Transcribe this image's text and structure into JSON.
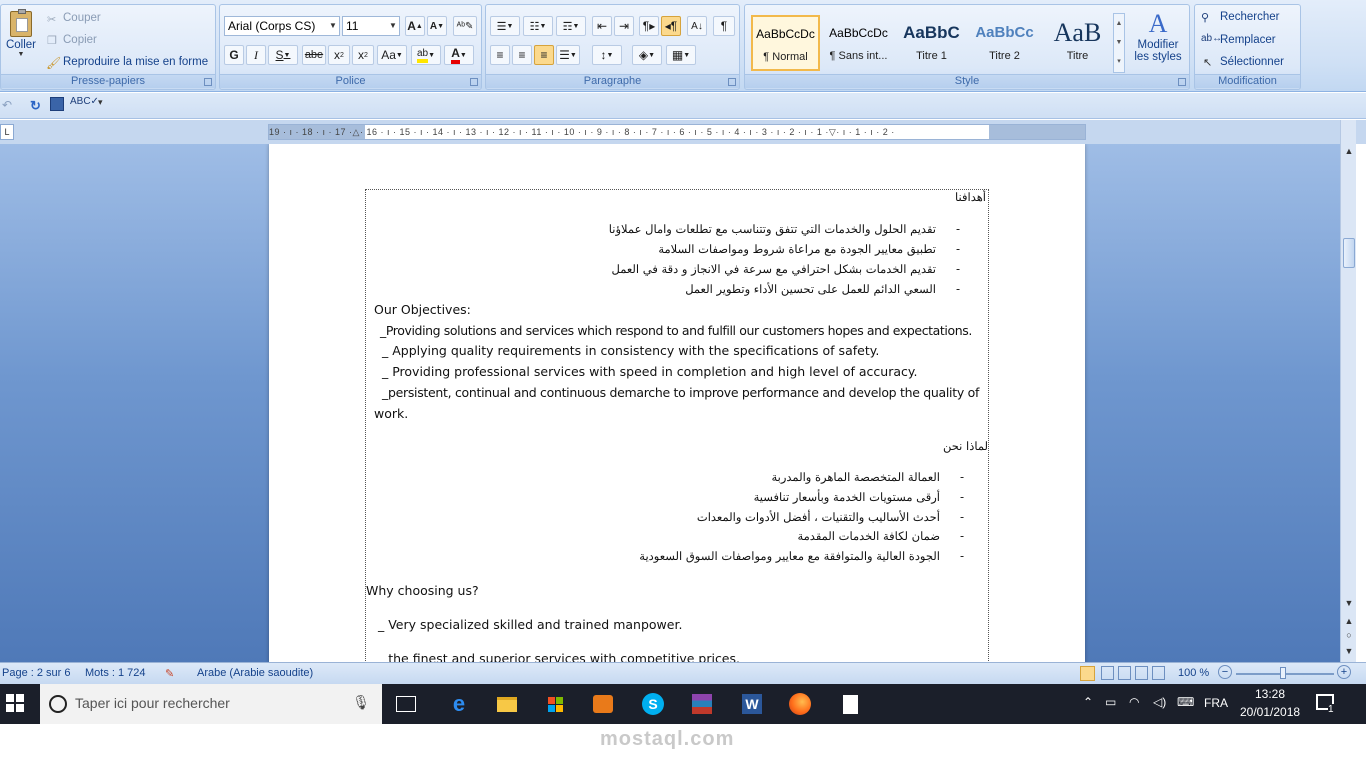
{
  "ribbon": {
    "clipboard": {
      "paste": "Coller",
      "cut": "Couper",
      "copy": "Copier",
      "format_painter": "Reproduire la mise en forme",
      "label": "Presse-papiers"
    },
    "font": {
      "font_name": "Arial (Corps CS)",
      "font_size": "11",
      "label": "Police"
    },
    "paragraph": {
      "label": "Paragraphe"
    },
    "styles": {
      "tiles": [
        {
          "preview": "AaBbCcDc",
          "name": "¶ Normal"
        },
        {
          "preview": "AaBbCcDc",
          "name": "¶ Sans int..."
        },
        {
          "preview": "AaBbC",
          "name": "Titre 1"
        },
        {
          "preview": "AaBbCc",
          "name": "Titre 2"
        },
        {
          "preview": "AaB",
          "name": "Titre"
        }
      ],
      "change_styles_1": "Modifier",
      "change_styles_2": "les styles",
      "label": "Style"
    },
    "editing": {
      "find": "Rechercher",
      "replace": "Remplacer",
      "select": "Sélectionner",
      "label": "Modification"
    }
  },
  "ruler": {
    "ticks": "19 · ı · 18 · ı · 17 ·△· 16 · ı · 15 · ı · 14 · ı · 13 · ı · 12 · ı · 11 · ı · 10 · ı · 9 · ı · 8 · ı · 7 · ı · 6 · ı · 5 · ı · 4 · ı · 3 · ı · 2 · ı · 1 ·▽· ı · 1 · ı · 2 ·"
  },
  "document": {
    "arabic_heading": "أهدافنا",
    "arabic_objectives": [
      "تقديم الحلول والخدمات التي تتفق وتتناسب مع تطلعات وامال عملاؤنا",
      "تطبيق معايير الجودة مع مراعاة شروط ومواصفات السلامة",
      "تقديم الخدمات بشكل احترافي مع سرعة في الانجاز و دقة في العمل",
      "السعي الدائم للعمل على تحسين الأداء وتطوير العمل"
    ],
    "en_heading": "Our Objectives:",
    "en_objectives": [
      "_Providing solutions and services which respond to and fulfill our customers hopes and expectations.",
      "_ Applying quality requirements in consistency with the specifications of safety.",
      "_ Providing professional services with speed in completion and high level of accuracy.",
      "_persistent, continual and continuous demarche to improve performance and develop the quality of"
    ],
    "en_objectives_wrap": "work.",
    "arabic_why": "لماذا نحن",
    "arabic_why_items": [
      "العمالة المتخصصة الماهرة والمدربة",
      "أرقى مستويات الخدمة وبأسعار تنافسية",
      "أحدث الأساليب والتقنيات ، أفضل الأدوات والمعدات",
      "ضمان لكافة الخدمات المقدمة",
      "الجودة العالية والمتوافقة مع معايير ومواصفات السوق السعودية"
    ],
    "why_heading": "Why choosing us?",
    "why_items": [
      "_ Very specialized skilled and trained manpower.",
      "_ the finest and superior services with competitive prices."
    ]
  },
  "status": {
    "page": "Page : 2 sur 6",
    "words": "Mots : 1 724",
    "language": "Arabe (Arabie saoudite)",
    "zoom": "100 %"
  },
  "taskbar": {
    "search_placeholder": "Taper ici pour rechercher",
    "lang": "FRA",
    "time": "13:28",
    "date": "20/01/2018",
    "notif_count": "1"
  },
  "watermark": "mostaql.com"
}
